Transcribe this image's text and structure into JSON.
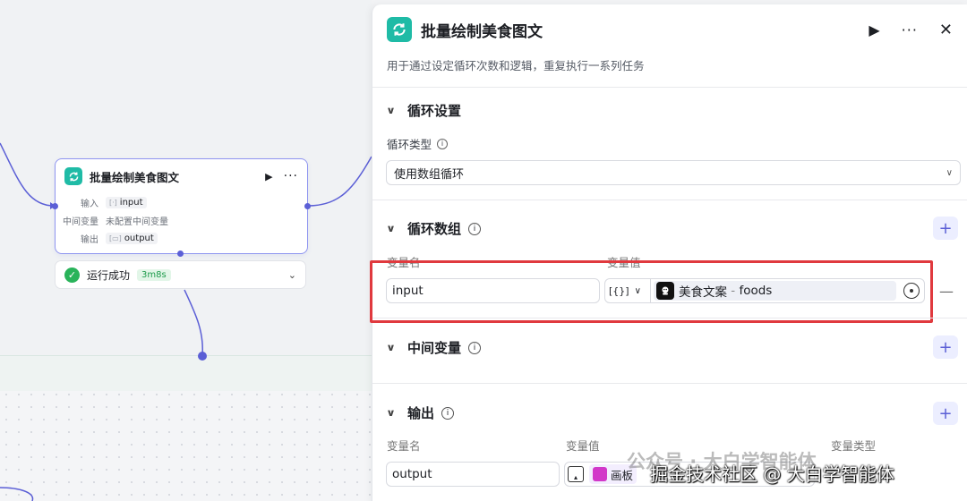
{
  "node": {
    "title": "批量绘制美食图文",
    "input_label": "输入",
    "input_value": "input",
    "mid_label": "中间变量",
    "mid_value": "未配置中间变量",
    "output_label": "输出",
    "output_value": "output",
    "status_text": "运行成功",
    "status_time": "3m8s"
  },
  "panel": {
    "title": "批量绘制美食图文",
    "description": "用于通过设定循环次数和逻辑，重复执行一系列任务",
    "loop_settings": {
      "title": "循环设置",
      "type_label": "循环类型",
      "type_value": "使用数组循环"
    },
    "loop_array": {
      "title": "循环数组",
      "col_name": "变量名",
      "col_value": "变量值",
      "var_name": "input",
      "type_glyph": "[{}]",
      "ref_source": "美食文案",
      "ref_sep": " - ",
      "ref_field": "foods"
    },
    "mid_vars": {
      "title": "中间变量"
    },
    "output": {
      "title": "输出",
      "col_name": "变量名",
      "col_value": "变量值",
      "col_type": "变量类型",
      "var_name": "output",
      "ref_label": "画板"
    }
  },
  "watermark": {
    "line1": "公众号 · 大白学智能体",
    "line2": "掘金技术社区 @ 大白学智能体"
  },
  "colors": {
    "accent": "#5b5fd6",
    "node_icon": "#1fbba6",
    "success": "#29b35a",
    "highlight": "#e0393e"
  }
}
